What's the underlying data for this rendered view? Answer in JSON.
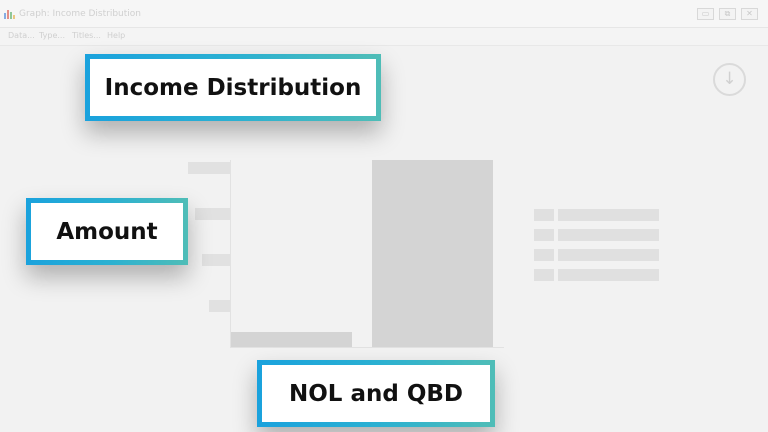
{
  "window": {
    "title": "Graph: Income Distribution",
    "controls": {
      "minimize": "▭",
      "maximize": "⧉",
      "close": "✕"
    }
  },
  "menu": [
    {
      "label": "Data..."
    },
    {
      "label": "Type..."
    },
    {
      "label": "Titles..."
    },
    {
      "label": "Help"
    }
  ],
  "toolbar": {
    "download_icon": "download-icon",
    "download_glyph": "↓"
  },
  "callouts": {
    "title": "Income Distribution",
    "y_axis": "Amount",
    "x_axis": "NOL and QBD"
  },
  "chart_data": {
    "type": "bar",
    "categories": [
      "",
      ""
    ],
    "series": [
      {
        "values": [
          0.08,
          1.0
        ]
      }
    ],
    "legend_entries": 4,
    "colors": {
      "bar": "#d4d4d4",
      "placeholder": "#e0e0e0"
    }
  },
  "colors": {
    "callout_gradient_start": "#1aa2dd",
    "callout_gradient_end": "#4fbdb7",
    "background": "#f2f2f2"
  }
}
